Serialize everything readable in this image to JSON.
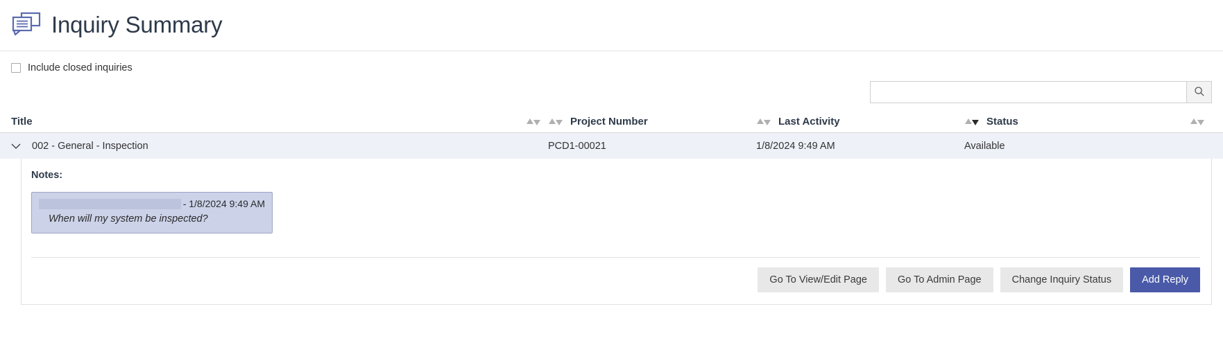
{
  "header": {
    "title": "Inquiry Summary",
    "icon": "speech-bubbles-icon"
  },
  "filter": {
    "include_closed_label": "Include closed inquiries",
    "include_closed_checked": false
  },
  "search": {
    "value": "",
    "placeholder": "",
    "button_icon": "search-icon"
  },
  "table": {
    "columns": [
      {
        "key": "title",
        "label": "Title",
        "sort_icon": "sort-both-icon",
        "sort_state": "none"
      },
      {
        "key": "project",
        "label": "Project Number",
        "sort_icon": "sort-both-icon",
        "sort_state": "none"
      },
      {
        "key": "last",
        "label": "Last Activity",
        "sort_icon": "sort-both-icon",
        "sort_state": "none"
      },
      {
        "key": "status",
        "label": "Status",
        "sort_icon": "sort-desc-icon",
        "sort_state": "desc"
      }
    ],
    "trailing_sort_icon": "sort-both-icon",
    "rows": [
      {
        "expander_icon": "chevron-down-icon",
        "expanded": true,
        "title": "002 - General - Inspection",
        "project_number": "PCD1-00021",
        "last_activity": "1/8/2024 9:49 AM",
        "status": "Available"
      }
    ]
  },
  "detail": {
    "notes_label": "Notes:",
    "notes": [
      {
        "author": "",
        "author_redacted": true,
        "date": "- 1/8/2024 9:49 AM",
        "body": "When will my system be inspected?"
      }
    ],
    "buttons": [
      {
        "label": "Go To View/Edit Page",
        "style": "default"
      },
      {
        "label": "Go To Admin Page",
        "style": "default"
      },
      {
        "label": "Change Inquiry Status",
        "style": "default"
      },
      {
        "label": "Add Reply",
        "style": "primary"
      }
    ]
  },
  "colors": {
    "primary_button": "#4a5aa8",
    "row_highlight": "#eef1f8",
    "note_card": "#ccd2e8",
    "title_text": "#2e3a4a"
  }
}
